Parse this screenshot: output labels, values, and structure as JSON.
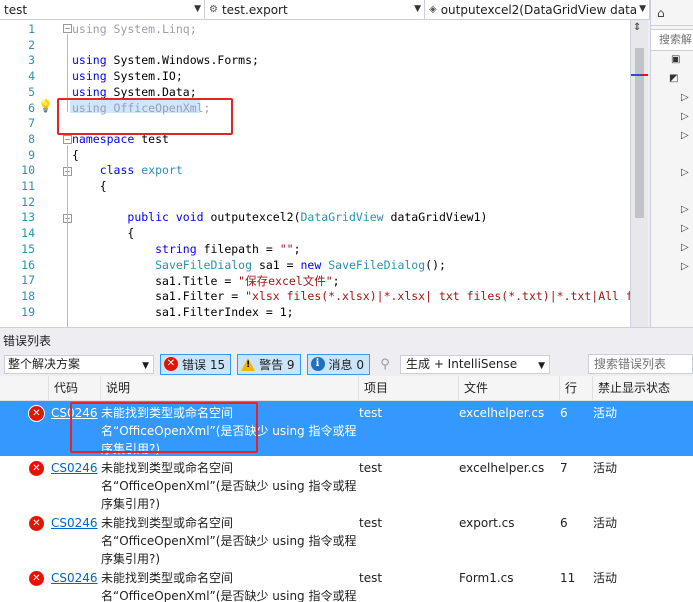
{
  "nav": {
    "project": "test",
    "class": "test.export",
    "member": "outputexcel2(DataGridView data"
  },
  "editor": {
    "line_numbers": [
      "1",
      "2",
      "3",
      "4",
      "5",
      "6",
      "7",
      "8",
      "9",
      "10",
      "11",
      "12",
      "13",
      "14",
      "15",
      "16",
      "17",
      "18",
      "19"
    ],
    "lines": [
      {
        "parts": [
          {
            "t": "using System.Linq;",
            "c": "dim"
          }
        ]
      },
      {
        "parts": []
      },
      {
        "parts": [
          {
            "t": "using",
            "c": "kw"
          },
          {
            "t": " System.Windows.Forms;",
            "c": ""
          }
        ]
      },
      {
        "parts": [
          {
            "t": "using",
            "c": "kw"
          },
          {
            "t": " System.IO;",
            "c": ""
          }
        ]
      },
      {
        "parts": [
          {
            "t": "using",
            "c": "kw"
          },
          {
            "t": " System.Data;",
            "c": ""
          }
        ]
      },
      {
        "parts": [
          {
            "t": "using OfficeOpenXml;",
            "c": "dim"
          }
        ]
      },
      {
        "parts": []
      },
      {
        "parts": [
          {
            "t": "namespace",
            "c": "kw"
          },
          {
            "t": " test",
            "c": ""
          }
        ]
      },
      {
        "parts": [
          {
            "t": "{",
            "c": ""
          }
        ]
      },
      {
        "parts": [
          {
            "t": "    ",
            "c": ""
          },
          {
            "t": "class",
            "c": "kw"
          },
          {
            "t": " ",
            "c": ""
          },
          {
            "t": "export",
            "c": "ty"
          }
        ]
      },
      {
        "parts": [
          {
            "t": "    {",
            "c": ""
          }
        ]
      },
      {
        "parts": []
      },
      {
        "parts": [
          {
            "t": "        ",
            "c": ""
          },
          {
            "t": "public void",
            "c": "kw"
          },
          {
            "t": " outputexcel2(",
            "c": ""
          },
          {
            "t": "DataGridView",
            "c": "ty"
          },
          {
            "t": " dataGridView1)",
            "c": ""
          }
        ]
      },
      {
        "parts": [
          {
            "t": "        {",
            "c": ""
          }
        ]
      },
      {
        "parts": [
          {
            "t": "            ",
            "c": ""
          },
          {
            "t": "string",
            "c": "kw"
          },
          {
            "t": " filepath = ",
            "c": ""
          },
          {
            "t": "\"\"",
            "c": "str"
          },
          {
            "t": ";",
            "c": ""
          }
        ]
      },
      {
        "parts": [
          {
            "t": "            ",
            "c": ""
          },
          {
            "t": "SaveFileDialog",
            "c": "ty"
          },
          {
            "t": " sa1 = ",
            "c": ""
          },
          {
            "t": "new",
            "c": "kw"
          },
          {
            "t": " ",
            "c": ""
          },
          {
            "t": "SaveFileDialog",
            "c": "ty"
          },
          {
            "t": "();",
            "c": ""
          }
        ]
      },
      {
        "parts": [
          {
            "t": "            sa1.Title = ",
            "c": ""
          },
          {
            "t": "\"保存excel文件\"",
            "c": "str"
          },
          {
            "t": ";",
            "c": ""
          }
        ]
      },
      {
        "parts": [
          {
            "t": "            sa1.Filter = ",
            "c": ""
          },
          {
            "t": "\"xlsx files(*.xlsx)|*.xlsx| txt files(*.txt)|*.txt|All files(*.",
            "c": "str"
          }
        ]
      },
      {
        "parts": [
          {
            "t": "            sa1.FilterIndex = 1;",
            "c": ""
          }
        ]
      }
    ]
  },
  "solution_explorer": {
    "search_placeholder": "搜索解"
  },
  "error_list": {
    "title": "错误列表",
    "scope": "整个解决方案",
    "errors_label": "错误 15",
    "warnings_label": "警告 9",
    "messages_label": "消息 0",
    "build_source": "生成 + IntelliSense",
    "search_placeholder": "搜索错误列表",
    "columns": [
      "代码",
      "说明",
      "项目",
      "文件",
      "行",
      "禁止显示状态"
    ],
    "rows": [
      {
        "code": "CS0246",
        "desc": "未能找到类型或命名空间名“OfficeOpenXml”(是否缺少 using 指令或程序集引用?)",
        "project": "test",
        "file": "excelhelper.cs",
        "line": "6",
        "state": "活动",
        "selected": true
      },
      {
        "code": "CS0246",
        "desc": "未能找到类型或命名空间名“OfficeOpenXml”(是否缺少 using 指令或程序集引用?)",
        "project": "test",
        "file": "excelhelper.cs",
        "line": "7",
        "state": "活动",
        "selected": false
      },
      {
        "code": "CS0246",
        "desc": "未能找到类型或命名空间名“OfficeOpenXml”(是否缺少 using 指令或程序集引用?)",
        "project": "test",
        "file": "export.cs",
        "line": "6",
        "state": "活动",
        "selected": false
      },
      {
        "code": "CS0246",
        "desc": "未能找到类型或命名空间名“OfficeOpenXml”(是否缺少 using 指令或程序集引用?)",
        "project": "test",
        "file": "Form1.cs",
        "line": "11",
        "state": "活动",
        "selected": false
      }
    ]
  },
  "colors": {
    "selection": "#3399ff",
    "error_red": "#e51400",
    "annotation_red": "#e5232a",
    "keyword_blue": "#0000ff",
    "type_teal": "#2b91af",
    "string_red": "#a31515"
  }
}
